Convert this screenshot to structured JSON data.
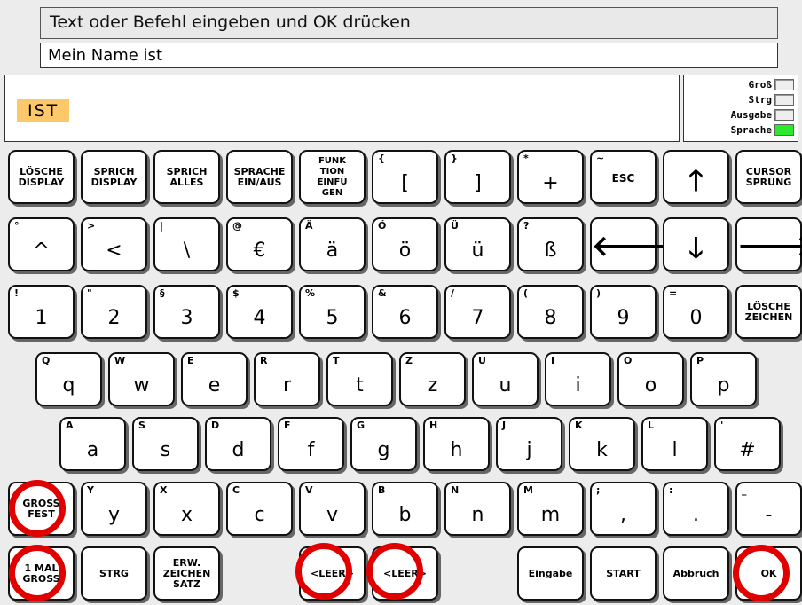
{
  "prompt": "Text oder Befehl eingeben und OK drücken",
  "input_value": "Mein Name ist",
  "display_word": "IST",
  "status": [
    {
      "label": "Groß",
      "on": false
    },
    {
      "label": "Strg",
      "on": false
    },
    {
      "label": "Ausgabe",
      "on": false
    },
    {
      "label": "Sprache",
      "on": true
    }
  ],
  "keys": {
    "loesche_display": "LÖSCHE\nDISPLAY",
    "sprich_display": "SPRICH\nDISPLAY",
    "sprich_alles": "SPRICH\nALLES",
    "sprache_einaus": "SPRACHE\nEIN/AUS",
    "funktion": "FUNK\nTION\nEINFÜ\nGEN",
    "bracket_open": {
      "sub": "{",
      "main": "["
    },
    "bracket_close": {
      "sub": "}",
      "main": "]"
    },
    "plus": {
      "sub": "*",
      "main": "+"
    },
    "esc": {
      "sub": "~",
      "main": "ESC"
    },
    "cursor_sprung": "CURSOR\nSPRUNG",
    "caret": {
      "sub": "°",
      "main": "^"
    },
    "less": {
      "sub": ">",
      "main": "<"
    },
    "backslash": {
      "sub": "|",
      "main": "\\"
    },
    "euro": {
      "sub": "@",
      "main": "€"
    },
    "ae": {
      "sub": "Ä",
      "main": "ä"
    },
    "oe": {
      "sub": "Ö",
      "main": "ö"
    },
    "ue": {
      "sub": "Ü",
      "main": "ü"
    },
    "sz": {
      "sub": "?",
      "main": "ß"
    },
    "digits": [
      {
        "sub": "!",
        "main": "1"
      },
      {
        "sub": "\"",
        "main": "2"
      },
      {
        "sub": "§",
        "main": "3"
      },
      {
        "sub": "$",
        "main": "4"
      },
      {
        "sub": "%",
        "main": "5"
      },
      {
        "sub": "&",
        "main": "6"
      },
      {
        "sub": "/",
        "main": "7"
      },
      {
        "sub": "(",
        "main": "8"
      },
      {
        "sub": ")",
        "main": "9"
      },
      {
        "sub": "=",
        "main": "0"
      }
    ],
    "loesche_zeichen": "LÖSCHE\nZEICHEN",
    "row_q": [
      {
        "sub": "Q",
        "main": "q"
      },
      {
        "sub": "W",
        "main": "w"
      },
      {
        "sub": "E",
        "main": "e"
      },
      {
        "sub": "R",
        "main": "r"
      },
      {
        "sub": "T",
        "main": "t"
      },
      {
        "sub": "Z",
        "main": "z"
      },
      {
        "sub": "U",
        "main": "u"
      },
      {
        "sub": "I",
        "main": "i"
      },
      {
        "sub": "O",
        "main": "o"
      },
      {
        "sub": "P",
        "main": "p"
      }
    ],
    "row_a": [
      {
        "sub": "A",
        "main": "a"
      },
      {
        "sub": "S",
        "main": "s"
      },
      {
        "sub": "D",
        "main": "d"
      },
      {
        "sub": "F",
        "main": "f"
      },
      {
        "sub": "G",
        "main": "g"
      },
      {
        "sub": "H",
        "main": "h"
      },
      {
        "sub": "J",
        "main": "j"
      },
      {
        "sub": "K",
        "main": "k"
      },
      {
        "sub": "L",
        "main": "l"
      },
      {
        "sub": "'",
        "main": "#"
      }
    ],
    "gross_fest": "GROSS\nFEST",
    "row_y": [
      {
        "sub": "Y",
        "main": "y"
      },
      {
        "sub": "X",
        "main": "x"
      },
      {
        "sub": "C",
        "main": "c"
      },
      {
        "sub": "V",
        "main": "v"
      },
      {
        "sub": "B",
        "main": "b"
      },
      {
        "sub": "N",
        "main": "n"
      },
      {
        "sub": "M",
        "main": "m"
      },
      {
        "sub": ";",
        "main": ","
      },
      {
        "sub": ":",
        "main": "."
      },
      {
        "sub": "_",
        "main": "-"
      }
    ],
    "einmal_gross": "1 MAL\nGROSS",
    "strg": "STRG",
    "erw_zeichensatz": "ERW.\nZEICHEN\nSATZ",
    "leer": "<LEER>",
    "eingabe": "Eingabe",
    "start": "START",
    "abbruch": "Abbruch",
    "ok": "OK"
  }
}
